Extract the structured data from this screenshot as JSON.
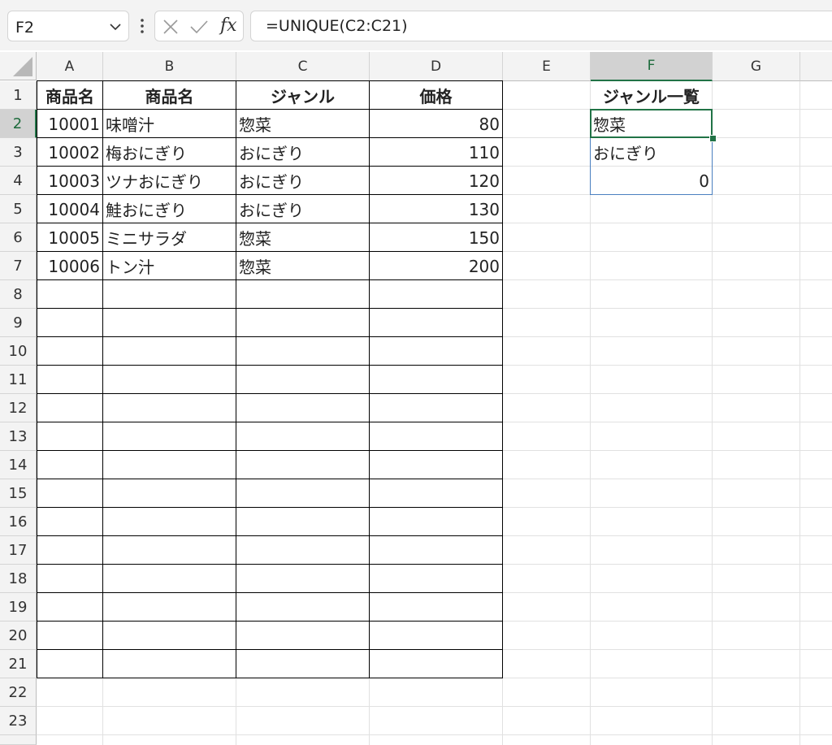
{
  "formula_bar": {
    "name_box": "F2",
    "formula": "=UNIQUE(C2:C21)",
    "fx_label": "fx"
  },
  "columns": [
    "A",
    "B",
    "C",
    "D",
    "E",
    "F",
    "G"
  ],
  "selected_column": "F",
  "rows": [
    "1",
    "2",
    "3",
    "4",
    "5",
    "6",
    "7",
    "8",
    "9",
    "10",
    "11",
    "12",
    "13",
    "14",
    "15",
    "16",
    "17",
    "18",
    "19",
    "20",
    "21",
    "22",
    "23"
  ],
  "selected_row": "2",
  "table": {
    "headers": [
      "商品名",
      "商品名",
      "ジャンル",
      "価格"
    ],
    "rows": [
      [
        "10001",
        "味噌汁",
        "惣菜",
        "80"
      ],
      [
        "10002",
        "梅おにぎり",
        "おにぎり",
        "110"
      ],
      [
        "10003",
        "ツナおにぎり",
        "おにぎり",
        "120"
      ],
      [
        "10004",
        "鮭おにぎり",
        "おにぎり",
        "130"
      ],
      [
        "10005",
        "ミニサラダ",
        "惣菜",
        "150"
      ],
      [
        "10006",
        "トン汁",
        "惣菜",
        "200"
      ]
    ]
  },
  "genre_list": {
    "header": "ジャンル一覧",
    "values": [
      "惣菜",
      "おにぎり",
      "0"
    ]
  },
  "colors": {
    "selection": "#217346",
    "range_border": "#4a7fc0",
    "header_bg": "#f3f3f3"
  }
}
